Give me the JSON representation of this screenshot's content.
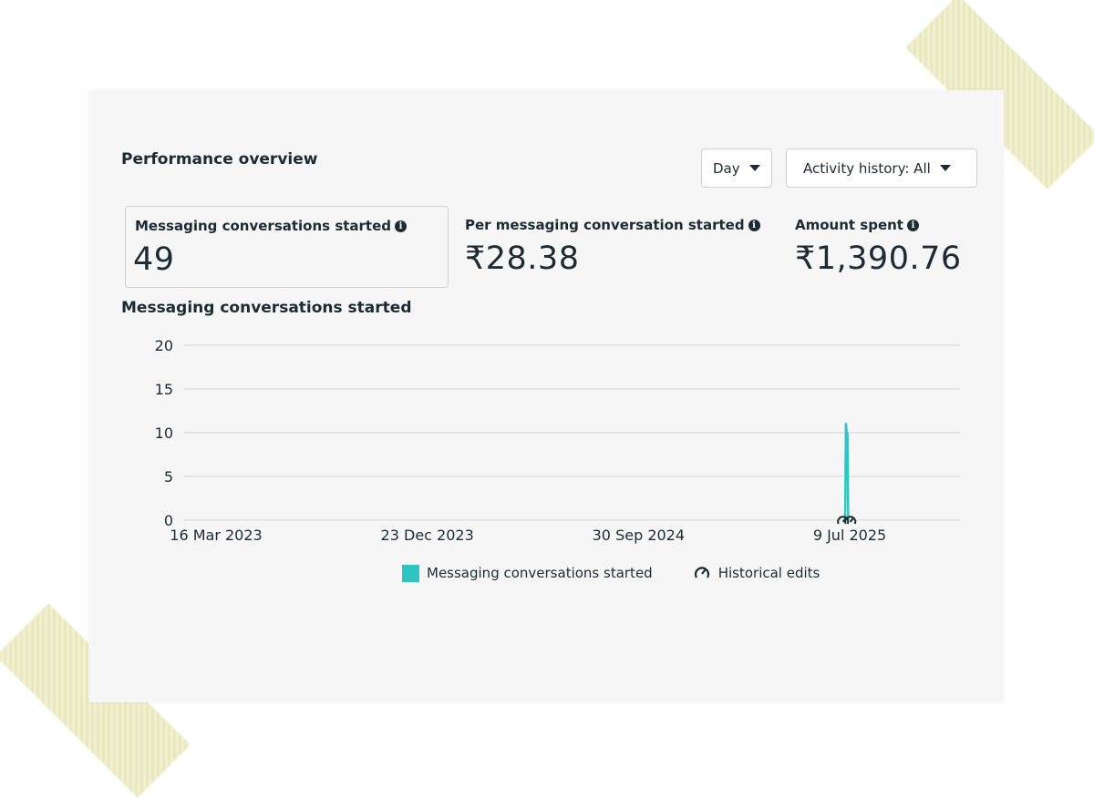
{
  "performance": {
    "title": "Performance overview",
    "day_label": "Day",
    "activity_label": "Activity history: All"
  },
  "metrics": [
    {
      "label": "Messaging conversations started",
      "value": "49"
    },
    {
      "label": "Per messaging conversation started",
      "value": "₹28.38"
    },
    {
      "label": "Amount spent",
      "value": "₹1,390.76"
    }
  ],
  "chart_section": {
    "title": "Messaging conversations started"
  },
  "chart_data": {
    "type": "line",
    "title": "",
    "xlabel": "",
    "ylabel": "",
    "ylim": [
      0,
      20
    ],
    "yticks": [
      "20",
      "15",
      "10",
      "5",
      "0"
    ],
    "xticks": [
      "16 Mar 2023",
      "23 Dec 2023",
      "30 Sep 2024",
      "9 Jul 2025"
    ],
    "grid": true,
    "legend": "bottom-center",
    "series": [
      {
        "name": "Messaging conversations started",
        "color": "#2ec4c4",
        "points": [
          {
            "x": "2025-07-03",
            "y": 0
          },
          {
            "x": "2025-07-04",
            "y": 11
          },
          {
            "x": "2025-07-05",
            "y": 10
          },
          {
            "x": "2025-07-06",
            "y": 10
          },
          {
            "x": "2025-07-07",
            "y": 0
          }
        ]
      }
    ],
    "legend_entries": [
      "Messaging conversations started",
      "Historical edits"
    ]
  },
  "colors": {
    "accent": "#2ec4c4",
    "text": "#1c2b33",
    "grid": "#dddfe2"
  },
  "icons": {
    "info": "info-icon",
    "historical_edits": "historical-edits-icon",
    "caret": "caret-down-icon"
  }
}
